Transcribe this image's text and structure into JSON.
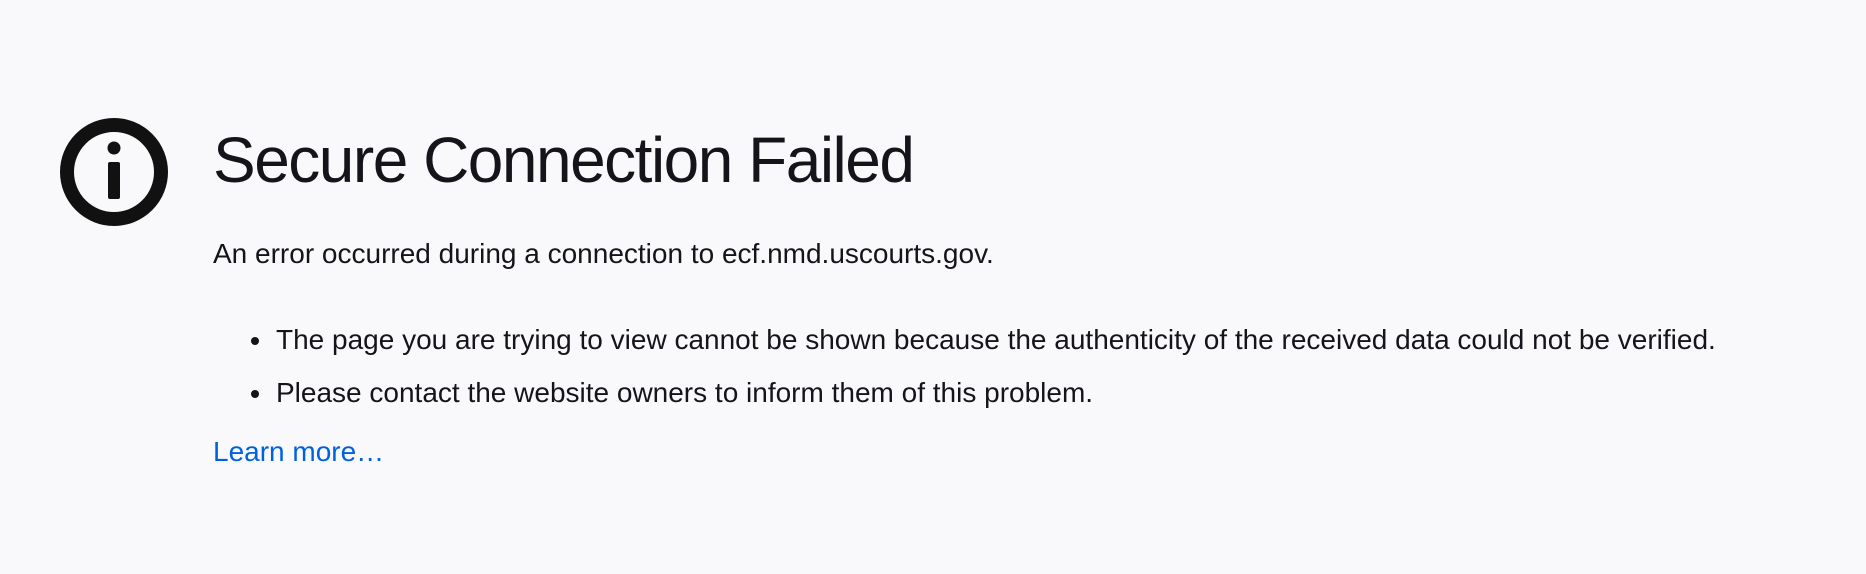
{
  "page": {
    "icon": "info-icon",
    "title": "Secure Connection Failed",
    "intro": "An error occurred during a connection to ecf.nmd.uscourts.gov.",
    "reasons": [
      "The page you are trying to view cannot be shown because the authenticity of the received data could not be verified.",
      "Please contact the website owners to inform them of this problem."
    ],
    "learn_more_label": "Learn more…"
  },
  "colors": {
    "background": "#f9f9fb",
    "text": "#15141a",
    "link": "#0061e0"
  }
}
